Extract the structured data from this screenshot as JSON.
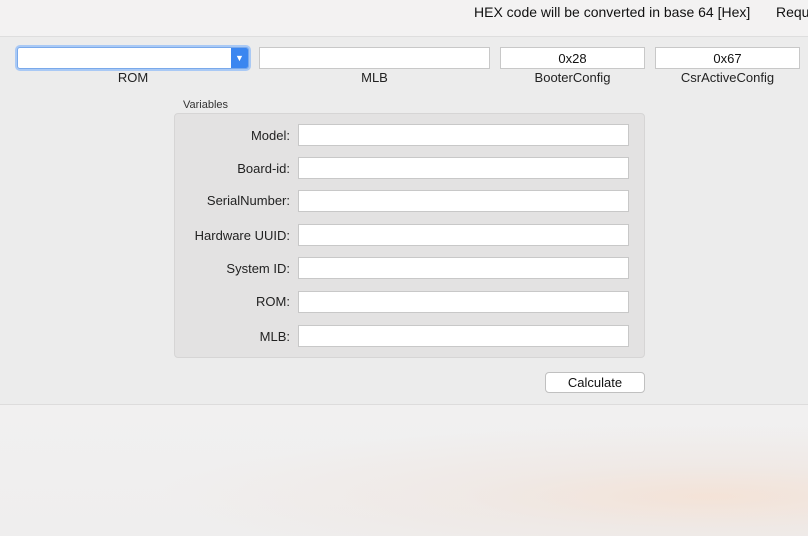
{
  "header": {
    "note": "HEX code will be converted in base 64 [Hex]",
    "note_2": "Requ"
  },
  "top_fields": {
    "rom": {
      "label": "ROM",
      "value": ""
    },
    "mlb": {
      "label": "MLB",
      "value": ""
    },
    "booter_config": {
      "label": "BooterConfig",
      "value": "0x28"
    },
    "csr_active_config": {
      "label": "CsrActiveConfig",
      "value": "0x67"
    }
  },
  "variables": {
    "title": "Variables",
    "rows": [
      {
        "label": "Model:",
        "value": ""
      },
      {
        "label": "Board-id:",
        "value": ""
      },
      {
        "label": "SerialNumber:",
        "value": ""
      },
      {
        "label": "Hardware UUID:",
        "value": ""
      },
      {
        "label": "System ID:",
        "value": ""
      },
      {
        "label": "ROM:",
        "value": ""
      },
      {
        "label": "MLB:",
        "value": ""
      }
    ]
  },
  "actions": {
    "calculate_label": "Calculate"
  },
  "colors": {
    "accent": "#3b86f0",
    "focus_ring": "#a9c9f5",
    "window_bg": "#ececec",
    "group_bg": "#e3e2e2"
  },
  "icons": {
    "combo_arrow": "chevron-down-icon"
  }
}
